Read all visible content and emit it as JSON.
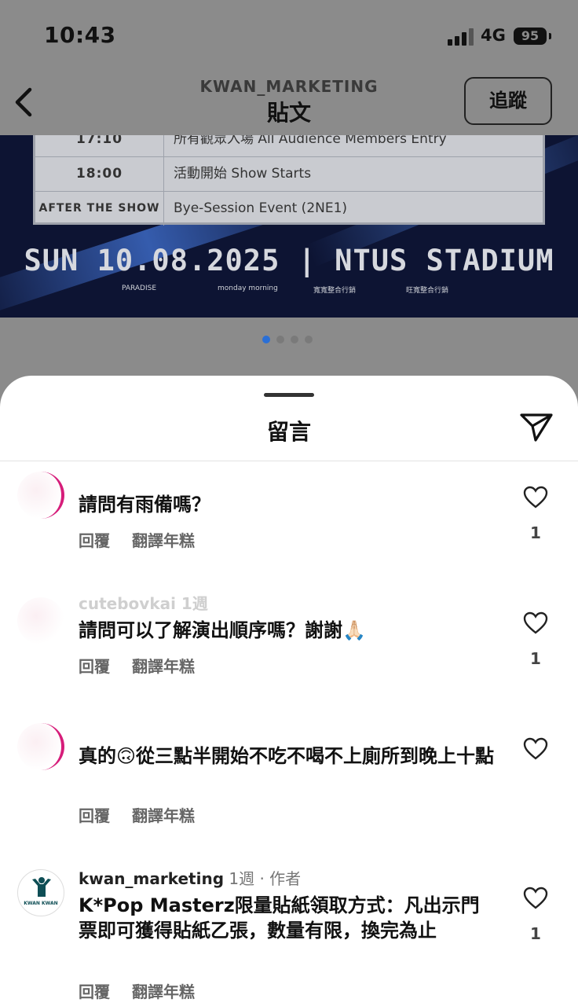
{
  "status_bar": {
    "time": "10:43",
    "network": "4G",
    "battery": "95"
  },
  "post_header": {
    "username": "KWAN_MARKETING",
    "title": "貼文",
    "follow_label": "追蹤"
  },
  "poster": {
    "schedule": [
      {
        "time": "17:10",
        "event": "所有觀眾入場  All Audience Members Entry"
      },
      {
        "time": "18:00",
        "event": "活動開始  Show Starts"
      },
      {
        "time": "AFTER THE SHOW",
        "event": "Bye-Session Event  (2NE1)"
      }
    ],
    "headline": "SUN  10.08.2025 | NTUS STADIUM",
    "sponsors": [
      "PARADISE",
      "monday morning",
      "寬寬整合行銷",
      "旺寬整合行銷"
    ]
  },
  "carousel": {
    "count": 4,
    "active": 0
  },
  "sheet": {
    "title": "留言"
  },
  "comments": [
    {
      "username": "",
      "meta": "",
      "text": "請問有雨備嗎？",
      "reply": "回覆",
      "translate": "翻譯年糕",
      "likes": "1",
      "avatar_ring": true
    },
    {
      "username": "cutebovkai",
      "meta": " 1週",
      "text": "請問可以了解演出順序嗎？謝謝🙏🏻",
      "reply": "回覆",
      "translate": "翻譯年糕",
      "likes": "1",
      "avatar_ring": false
    },
    {
      "username": "",
      "meta": "",
      "text": "真的🙃從三點半開始不吃不喝不上廁所到晚上十點",
      "reply": "回覆",
      "translate": "翻譯年糕",
      "likes": "",
      "avatar_ring": true
    },
    {
      "username": "kwan_marketing",
      "meta": " 1週 · 作者",
      "text": "K*Pop Masterz限量貼紙領取方式：凡出示門票即可獲得貼紙乙張，數量有限，換完為止",
      "reply": "回覆",
      "translate": "翻譯年糕",
      "likes": "1",
      "avatar_label": "KWAN KWAN"
    }
  ],
  "colors": {
    "accent_ring": "#d61d7a",
    "logo": "#0e4e55"
  }
}
